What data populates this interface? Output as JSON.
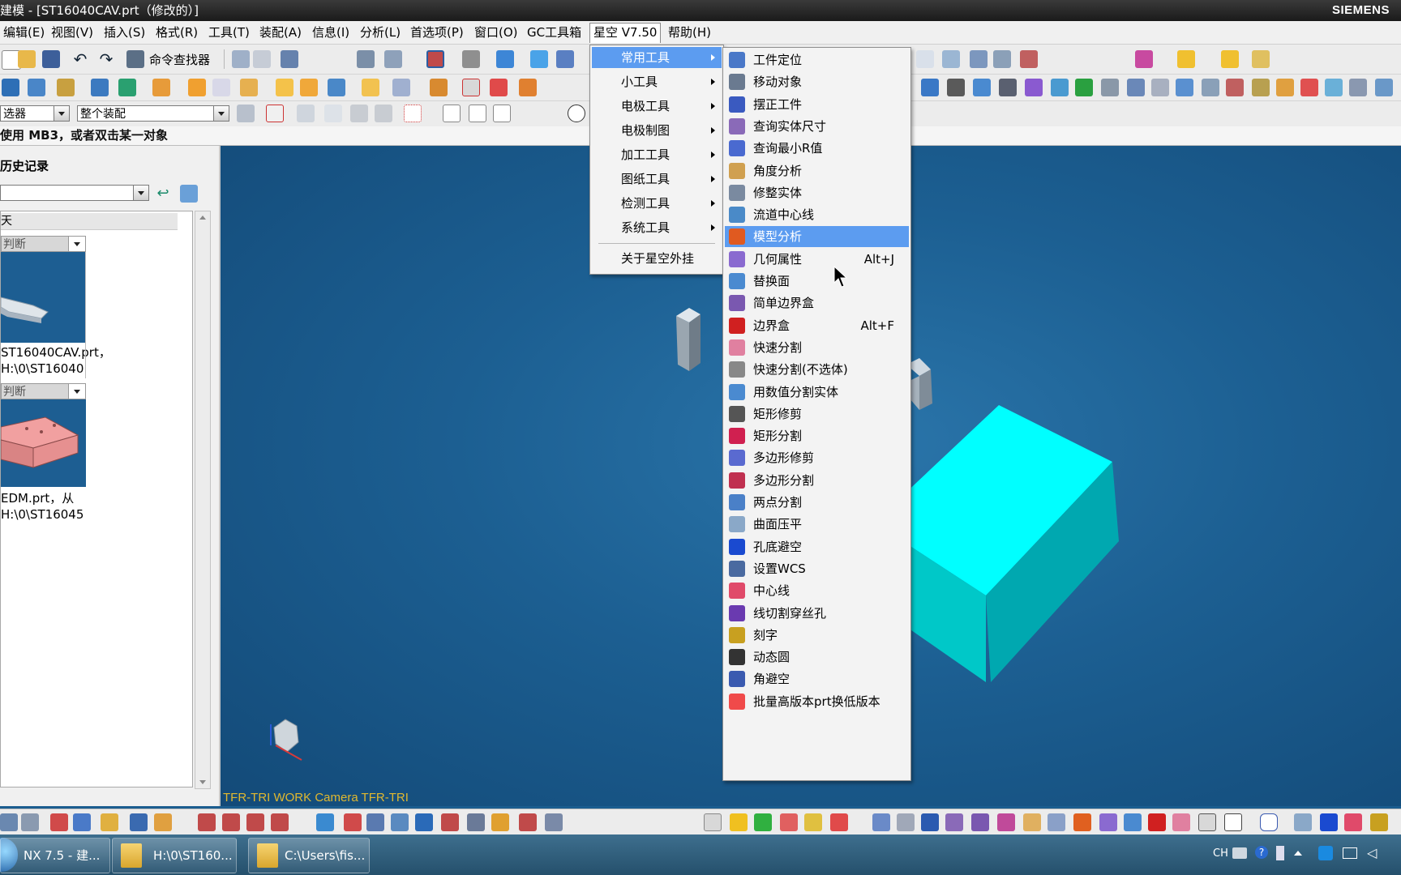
{
  "window": {
    "title": "建模 - [ST16040CAV.prt（修改的）]",
    "brand": "SIEMENS"
  },
  "menubar": {
    "items": [
      "编辑(E)",
      "视图(V)",
      "插入(S)",
      "格式(R)",
      "工具(T)",
      "装配(A)",
      "信息(I)",
      "分析(L)",
      "首选项(P)",
      "窗口(O)",
      "GC工具箱",
      "星空 V7.50",
      "帮助(H)"
    ],
    "active": "星空 V7.50"
  },
  "toolbar": {
    "command_finder": "命令查找器"
  },
  "selection_bar": {
    "filter": "选器",
    "scope": "整个装配"
  },
  "cue_line": "使用 MB3，或者双击某一对象",
  "history_panel": {
    "title": "历史记录",
    "group_label": "天",
    "items": [
      {
        "header": "判断",
        "line1": "ST16040CAV.prt，",
        "line2": "H:\\0\\ST16040"
      },
      {
        "header": "判断",
        "line1": "EDM.prt，从",
        "line2": "H:\\0\\ST16045"
      }
    ]
  },
  "viewport": {
    "label": "TFR-TRI WORK Camera TFR-TRI"
  },
  "xingkong_menu": {
    "items": [
      "常用工具",
      "小工具",
      "电极工具",
      "电极制图",
      "加工工具",
      "图纸工具",
      "检测工具",
      "系统工具"
    ],
    "highlighted": "常用工具",
    "about": "关于星空外挂"
  },
  "common_tools_submenu": {
    "highlighted": "模型分析",
    "items": [
      {
        "label": "工件定位",
        "shortcut": "",
        "icon": "workpiece-locate-icon"
      },
      {
        "label": "移动对象",
        "shortcut": "",
        "icon": "move-object-icon"
      },
      {
        "label": "摆正工件",
        "shortcut": "",
        "icon": "align-workpiece-icon"
      },
      {
        "label": "查询实体尺寸",
        "shortcut": "",
        "icon": "query-size-icon"
      },
      {
        "label": "查询最小R值",
        "shortcut": "",
        "icon": "query-min-radius-icon"
      },
      {
        "label": "角度分析",
        "shortcut": "",
        "icon": "angle-analysis-icon"
      },
      {
        "label": "修整实体",
        "shortcut": "",
        "icon": "trim-body-icon"
      },
      {
        "label": "流道中心线",
        "shortcut": "",
        "icon": "runner-centerline-icon"
      },
      {
        "label": "模型分析",
        "shortcut": "",
        "icon": "model-analysis-icon"
      },
      {
        "label": "几何属性",
        "shortcut": "Alt+J",
        "icon": "geometry-properties-icon"
      },
      {
        "label": "替换面",
        "shortcut": "",
        "icon": "replace-face-icon"
      },
      {
        "label": "简单边界盒",
        "shortcut": "",
        "icon": "simple-bounding-box-icon"
      },
      {
        "label": "边界盒",
        "shortcut": "Alt+F",
        "icon": "bounding-box-icon"
      },
      {
        "label": "快速分割",
        "shortcut": "",
        "icon": "quick-split-icon"
      },
      {
        "label": "快速分割(不选体)",
        "shortcut": "",
        "icon": "quick-split-nobody-icon"
      },
      {
        "label": "用数值分割实体",
        "shortcut": "",
        "icon": "split-by-value-icon"
      },
      {
        "label": "矩形修剪",
        "shortcut": "",
        "icon": "rect-trim-icon"
      },
      {
        "label": "矩形分割",
        "shortcut": "",
        "icon": "rect-split-icon"
      },
      {
        "label": "多边形修剪",
        "shortcut": "",
        "icon": "polygon-trim-icon"
      },
      {
        "label": "多边形分割",
        "shortcut": "",
        "icon": "polygon-split-icon"
      },
      {
        "label": "两点分割",
        "shortcut": "",
        "icon": "two-point-split-icon"
      },
      {
        "label": "曲面压平",
        "shortcut": "",
        "icon": "flatten-surface-icon"
      },
      {
        "label": "孔底避空",
        "shortcut": "",
        "icon": "hole-bottom-clear-icon"
      },
      {
        "label": "设置WCS",
        "shortcut": "",
        "icon": "set-wcs-icon"
      },
      {
        "label": "中心线",
        "shortcut": "",
        "icon": "centerline-icon"
      },
      {
        "label": "线切割穿丝孔",
        "shortcut": "",
        "icon": "wire-cut-hole-icon"
      },
      {
        "label": "刻字",
        "shortcut": "",
        "icon": "engrave-text-icon"
      },
      {
        "label": "动态圆",
        "shortcut": "",
        "icon": "dynamic-circle-icon"
      },
      {
        "label": "角避空",
        "shortcut": "",
        "icon": "corner-clear-icon"
      },
      {
        "label": "批量高版本prt换低版本",
        "shortcut": "",
        "icon": "batch-convert-icon"
      }
    ]
  },
  "taskbar": {
    "tasks": [
      "NX 7.5 - 建...",
      "H:\\0\\ST160...",
      "C:\\Users\\fis..."
    ],
    "lang": "CH"
  },
  "colors": {
    "viewport_bg": "#1c5f92",
    "menu_highlight": "#5c9cf0",
    "solid_cyan": "#00ffff",
    "label_yellow": "#e0b830"
  }
}
